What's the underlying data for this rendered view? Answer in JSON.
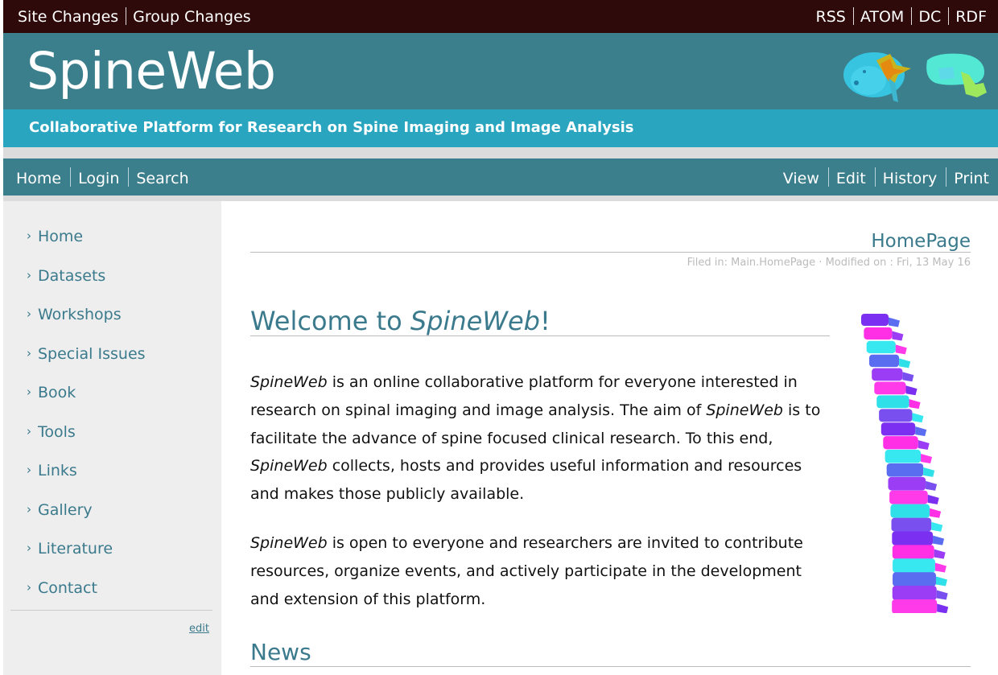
{
  "topbar": {
    "left_links": [
      "Site Changes",
      "Group Changes"
    ],
    "right_links": [
      "RSS",
      "ATOM",
      "DC",
      "RDF"
    ]
  },
  "header": {
    "site_title": "SpineWeb",
    "tagline": "Collaborative Platform for Research on Spine Imaging and Image Analysis"
  },
  "nav": {
    "left": [
      "Home",
      "Login",
      "Search"
    ],
    "right": [
      "View",
      "Edit",
      "History",
      "Print"
    ]
  },
  "sidebar": {
    "items": [
      "Home",
      "Datasets",
      "Workshops",
      "Special Issues",
      "Book",
      "Tools",
      "Links",
      "Gallery",
      "Literature",
      "Contact"
    ],
    "chevron": "›",
    "edit_label": "edit"
  },
  "main": {
    "page_title": "HomePage",
    "file_info": "Filed in: Main.HomePage · Modified on : Fri, 13 May 16",
    "welcome_prefix": "Welcome to ",
    "welcome_name": "SpineWeb",
    "welcome_suffix": "!",
    "p1": [
      {
        "t": "SpineWeb",
        "i": true
      },
      {
        "t": " is an online collaborative platform for everyone interested in research on spinal imaging and image analysis. The aim of ",
        "i": false
      },
      {
        "t": "SpineWeb",
        "i": true
      },
      {
        "t": " is to facilitate the advance of spine focused clinical research. To this end, ",
        "i": false
      },
      {
        "t": "SpineWeb",
        "i": true
      },
      {
        "t": " collects, hosts and provides useful information and resources and makes those publicly available.",
        "i": false
      }
    ],
    "p2": [
      {
        "t": "SpineWeb",
        "i": true
      },
      {
        "t": " is open to everyone and researchers are invited to contribute resources, organize events, and actively participate in the development and extension of this platform.",
        "i": false
      }
    ],
    "news_heading": "News"
  },
  "icons": {
    "logo": "vertebra-logo-icon",
    "spine": "spine-illustration-icon"
  },
  "colors": {
    "topbar": "#2f0a0a",
    "header": "#3b7e8c",
    "tagline_bar": "#2aa5c0",
    "accent_text": "#3a7a8c",
    "sidebar_bg": "#eeeeee"
  }
}
